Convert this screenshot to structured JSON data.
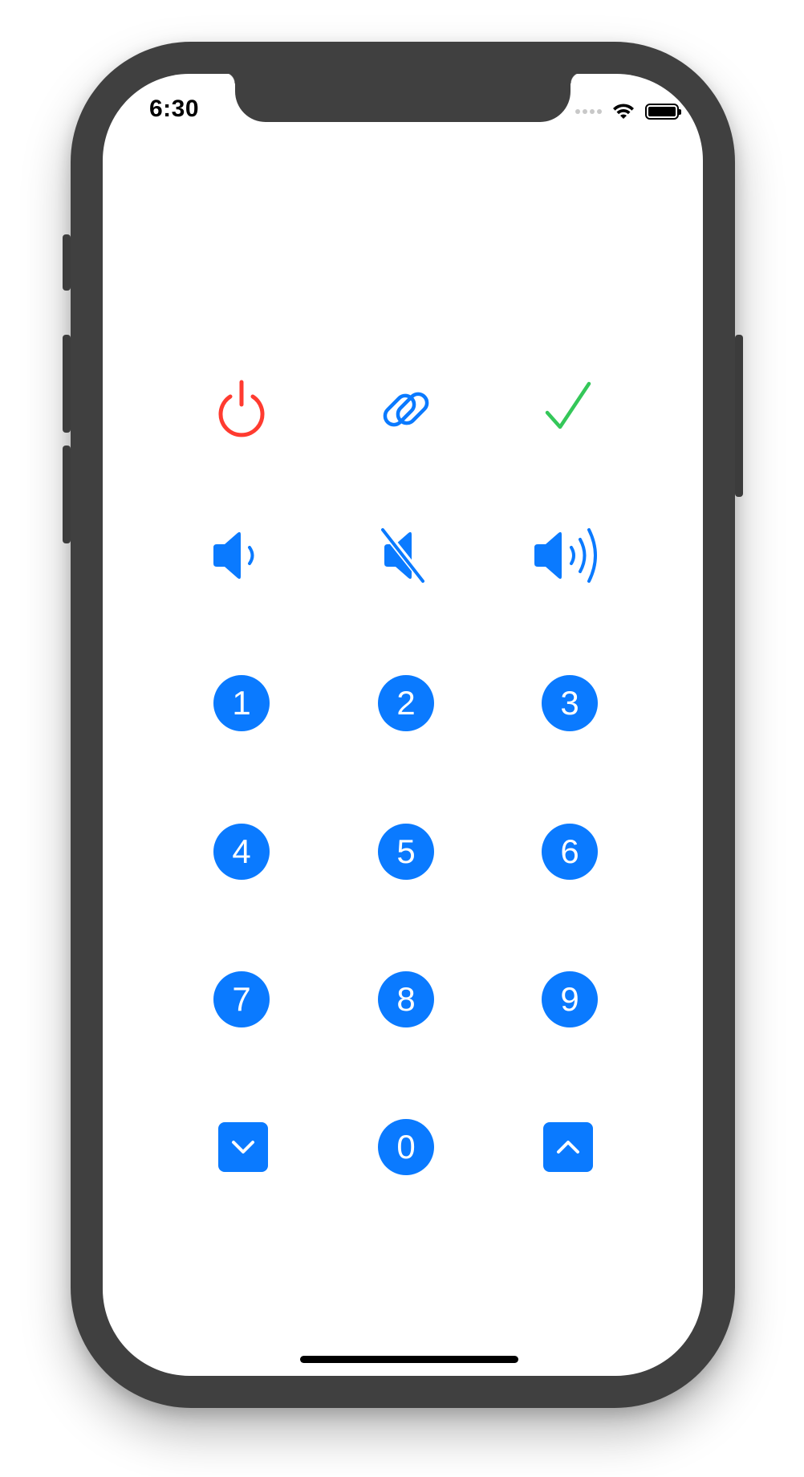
{
  "status_bar": {
    "time": "6:30"
  },
  "colors": {
    "blue": "#0a7aff",
    "red": "#ff3b30",
    "green": "#34c759",
    "frame": "#404040"
  },
  "icon_row": [
    {
      "icon": "power-icon"
    },
    {
      "icon": "link-icon"
    },
    {
      "icon": "checkmark-icon"
    }
  ],
  "volume_row": [
    {
      "icon": "speaker-low-icon"
    },
    {
      "icon": "speaker-muted-icon"
    },
    {
      "icon": "speaker-high-icon"
    }
  ],
  "keypad": {
    "keys": [
      "1",
      "2",
      "3",
      "4",
      "5",
      "6",
      "7",
      "8",
      "9"
    ],
    "zero": "0",
    "down_icon": "chevron-down-icon",
    "up_icon": "chevron-up-icon"
  }
}
